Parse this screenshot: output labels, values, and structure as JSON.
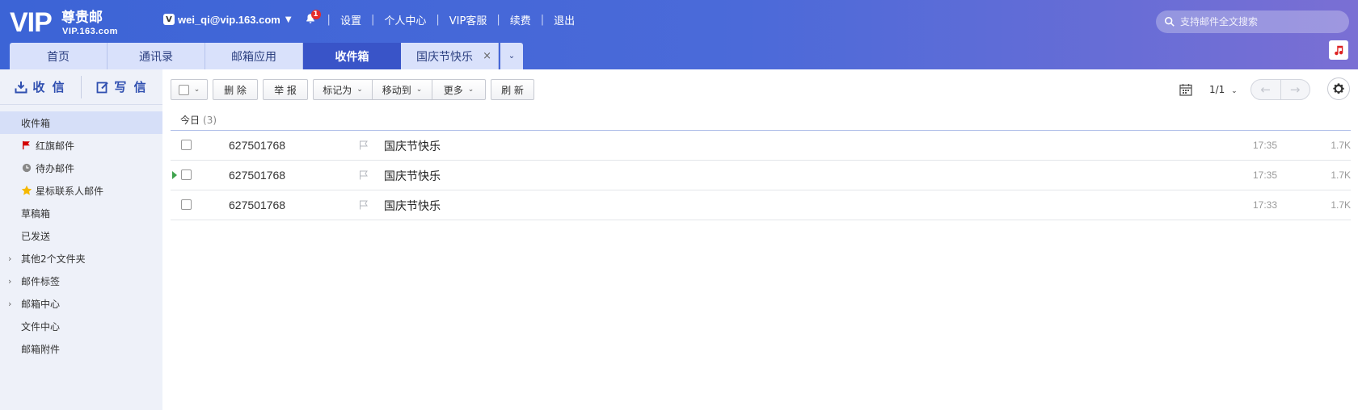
{
  "brand": {
    "logo_main": "VIP",
    "logo_zh": "尊贵邮",
    "logo_domain": "VIP.163.com"
  },
  "topnav": {
    "badge_letter": "V",
    "email": "wei_qi@vip.163.com",
    "notification_count": "1",
    "links": [
      "设置",
      "个人中心",
      "VIP客服",
      "续费",
      "退出"
    ]
  },
  "search": {
    "placeholder": "支持邮件全文搜索"
  },
  "tabs": [
    "首页",
    "通讯录",
    "邮箱应用",
    "收件箱",
    "国庆节快乐"
  ],
  "tab_close": "×",
  "sidebar": {
    "receive_label": "收 信",
    "compose_label": "写 信",
    "folders": [
      {
        "label": "收件箱"
      },
      {
        "label": "红旗邮件"
      },
      {
        "label": "待办邮件"
      },
      {
        "label": "星标联系人邮件"
      },
      {
        "label": "草稿箱"
      },
      {
        "label": "已发送"
      },
      {
        "label": "其他2个文件夹"
      },
      {
        "label": "邮件标签"
      },
      {
        "label": "邮箱中心"
      },
      {
        "label": "文件中心"
      },
      {
        "label": "邮箱附件"
      }
    ]
  },
  "toolbar": {
    "delete": "删 除",
    "report": "举 报",
    "mark_as": "标记为",
    "move_to": "移动到",
    "more": "更多",
    "refresh": "刷 新"
  },
  "pager": {
    "page": "1/1"
  },
  "list": {
    "group_label": "今日",
    "group_count": "(3)",
    "rows": [
      {
        "from": "627501768",
        "subject": "国庆节快乐",
        "time": "17:35",
        "size": "1.7K",
        "unread": false
      },
      {
        "from": "627501768",
        "subject": "国庆节快乐",
        "time": "17:35",
        "size": "1.7K",
        "unread": true
      },
      {
        "from": "627501768",
        "subject": "国庆节快乐",
        "time": "17:33",
        "size": "1.7K",
        "unread": false
      }
    ]
  },
  "colors": {
    "header_start": "#3c64d6",
    "header_end": "#7a6fd4",
    "active_tab": "#3954c8",
    "sidebar_bg": "#eef1f9"
  }
}
